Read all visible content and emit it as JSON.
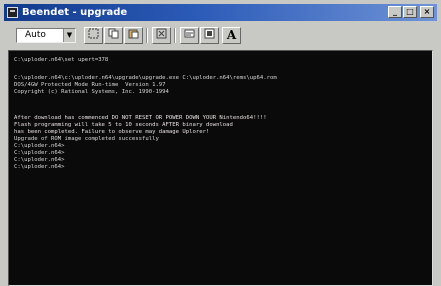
{
  "window": {
    "title": "Beendet - upgrade",
    "controls": [
      "_",
      "□",
      "×"
    ]
  },
  "toolbar": {
    "font_size_value": "Auto",
    "dropdown_arrow": "▼",
    "font_button_label": "A"
  },
  "console": {
    "lines": [
      "C:\\uploder.n64\\set upert=378",
      "C:\\uploder.n64\\c:\\uploder.n64\\upgrade\\upgrade.exe C:\\uploder.n64\\rems\\up64.rom",
      "DOS/4GW Protected Mode Run-time  Version 1.97",
      "Copyright (c) Rational Systems, Inc. 1990-1994",
      "After download has commenced DO NOT RESET OR POWER DOWN YOUR Nintendo64!!!!",
      "Flash programming will take 5 to 10 seconds AFTER binary download",
      "has been completed. Failure to observe may damage Uplorer!",
      "Upgrade of ROM image completed successfully",
      "C:\\uploder.n64>",
      "C:\\uploder.n64>",
      "C:\\uploder.n64>",
      "C:\\uploder.n64>"
    ]
  }
}
